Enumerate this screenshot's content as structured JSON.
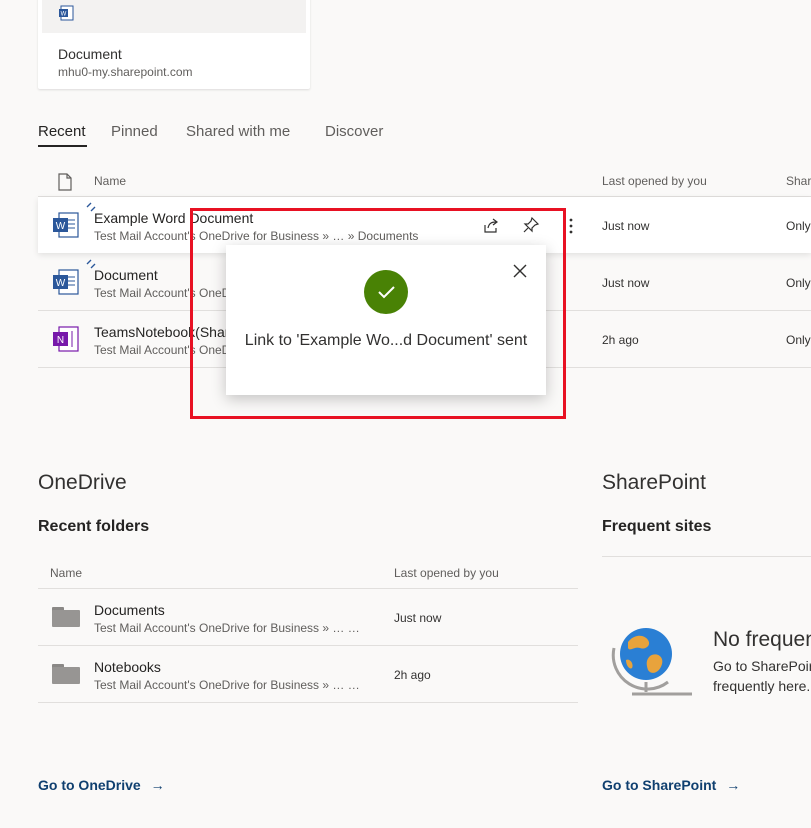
{
  "top_card": {
    "title": "Document",
    "subtitle": "mhu0-my.sharepoint.com"
  },
  "tabs": [
    {
      "label": "Recent",
      "active": true
    },
    {
      "label": "Pinned",
      "active": false
    },
    {
      "label": "Shared with me",
      "active": false
    },
    {
      "label": "Discover",
      "active": false
    }
  ],
  "recent_table": {
    "col_name": "Name",
    "col_last_opened": "Last opened by you",
    "col_sharing": "Shari",
    "rows": [
      {
        "name": "Example Word Document",
        "path": "Test Mail Account's OneDrive for Business » … » Documents",
        "date": "Just now",
        "sharing": "Only",
        "icon": "word-icon"
      },
      {
        "name": "Document",
        "path": "Test Mail Account's OneD",
        "date": "Just now",
        "sharing": "Only",
        "icon": "word-icon"
      },
      {
        "name": "TeamsNotebook(Shar",
        "path": "Test Mail Account's OneD",
        "date": "2h ago",
        "sharing": "Only",
        "icon": "onenote-icon"
      }
    ]
  },
  "popup": {
    "message": "Link to 'Example Wo...d Document' sent"
  },
  "onedrive": {
    "title": "OneDrive",
    "subtitle": "Recent folders",
    "col_name": "Name",
    "col_last_opened": "Last opened by you",
    "folders": [
      {
        "name": "Documents",
        "path": "Test Mail Account's OneDrive for Business » … …",
        "date": "Just now"
      },
      {
        "name": "Notebooks",
        "path": "Test Mail Account's OneDrive for Business » … …",
        "date": "2h ago"
      }
    ],
    "link": "Go to OneDrive"
  },
  "sharepoint": {
    "title": "SharePoint",
    "subtitle": "Frequent sites",
    "empty_title": "No frequen",
    "empty_line1": "Go to SharePoir",
    "empty_line2": "frequently here.",
    "link": "Go to SharePoint"
  },
  "colors": {
    "accent": "#0f3f6f",
    "success": "#498205",
    "highlight_box": "#e81123",
    "word": "#2b579a",
    "onenote": "#7719aa"
  }
}
